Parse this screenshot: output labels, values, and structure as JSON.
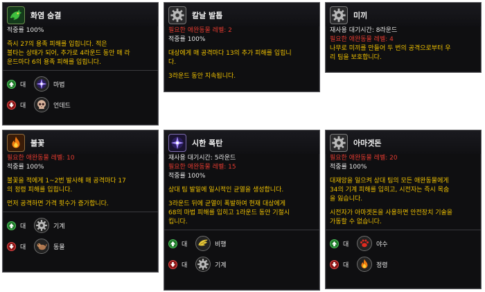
{
  "cards": [
    {
      "title": "화염 숨결",
      "icon": "dragon-head-icon",
      "lines": [
        {
          "text": "적중률 100%",
          "color": "w"
        },
        {
          "text": "",
          "color": "gap"
        },
        {
          "text": "즉시 27의 용족 피해를 입힙니다. 적은",
          "color": "y"
        },
        {
          "text": "불타는 상태가 되어, 추가로 4라운드 동안 매 라",
          "color": "y"
        },
        {
          "text": "운드마다 6의 용족 피해를 입힙니다.",
          "color": "y"
        }
      ],
      "relations": [
        {
          "dir": "up",
          "label": "대",
          "icon": "magic-star-icon",
          "type": "마법"
        },
        {
          "dir": "down",
          "label": "대",
          "icon": "skull-icon",
          "type": "언데드"
        }
      ]
    },
    {
      "title": "칼날 발톱",
      "icon": "gear-icon",
      "lines": [
        {
          "text": "필요한 애완동물 레벨: 2",
          "color": "r"
        },
        {
          "text": "적중률 100%",
          "color": "w"
        },
        {
          "text": "",
          "color": "gap"
        },
        {
          "text": "대상에게 매 공격마다 13의 추가 피해를 입힙니",
          "color": "y"
        },
        {
          "text": "다.",
          "color": "y"
        },
        {
          "text": "",
          "color": "gap"
        },
        {
          "text": "3라운드 동안 지속됩니다.",
          "color": "y"
        }
      ],
      "relations": []
    },
    {
      "title": "미끼",
      "icon": "gear-icon",
      "lines": [
        {
          "text": "재사용 대기시간: 8라운드",
          "color": "w"
        },
        {
          "text": "필요한 애완동물 레벨: 4",
          "color": "r"
        },
        {
          "text": "나무로 미끼를 만들어 두 번의 공격으로부터 우",
          "color": "y"
        },
        {
          "text": "리 팀을 보호합니다.",
          "color": "y"
        }
      ],
      "relations": []
    },
    {
      "title": "불꽃",
      "icon": "flame-icon",
      "lines": [
        {
          "text": "필요한 애완동물 레벨: 10",
          "color": "r"
        },
        {
          "text": "적중률 100%",
          "color": "w"
        },
        {
          "text": "",
          "color": "gap"
        },
        {
          "text": "불꽃을 적에게 1~2번 발사해 매 공격마다 17",
          "color": "y"
        },
        {
          "text": "의 정령 피해를 입힙니다.",
          "color": "y"
        },
        {
          "text": "",
          "color": "gap"
        },
        {
          "text": "먼저 공격하면 가격 횟수가 증가합니다.",
          "color": "y"
        }
      ],
      "relations": [
        {
          "dir": "up",
          "label": "대",
          "icon": "gear-icon",
          "type": "기계"
        },
        {
          "dir": "down",
          "label": "대",
          "icon": "paw-beast-icon",
          "type": "동물"
        }
      ]
    },
    {
      "title": "시한 폭탄",
      "icon": "magic-star-icon",
      "lines": [
        {
          "text": "재사용 대기시간: 5라운드",
          "color": "w"
        },
        {
          "text": "필요한 애완동물 레벨: 15",
          "color": "r"
        },
        {
          "text": "적중률 100%",
          "color": "w"
        },
        {
          "text": "",
          "color": "gap"
        },
        {
          "text": "상대 팀 발밑에 일시적인 균열을 생성합니다.",
          "color": "y"
        },
        {
          "text": "",
          "color": "gap"
        },
        {
          "text": "3라운드 뒤에 균열이 폭발하여 현재 대상에게",
          "color": "y"
        },
        {
          "text": "68의 마법 피해를 입히고 1라운드 동안 기절시",
          "color": "y"
        },
        {
          "text": "킵니다.",
          "color": "y"
        }
      ],
      "relations": [
        {
          "dir": "up",
          "label": "대",
          "icon": "wing-icon",
          "type": "비행"
        },
        {
          "dir": "down",
          "label": "대",
          "icon": "gear-icon",
          "type": "기계"
        }
      ]
    },
    {
      "title": "아마겟돈",
      "icon": "gear-icon",
      "lines": [
        {
          "text": "필요한 애완동물 레벨: 20",
          "color": "r"
        },
        {
          "text": "적중률 100%",
          "color": "w"
        },
        {
          "text": "",
          "color": "gap"
        },
        {
          "text": "대재앙을 일으켜 상대 팀의 모든 애완동물에게",
          "color": "y"
        },
        {
          "text": "34의 기계 피해를 입히고, 시전자는 즉시 목숨",
          "color": "y"
        },
        {
          "text": "을 잃습니다.",
          "color": "y"
        },
        {
          "text": "",
          "color": "gap"
        },
        {
          "text": "시전자가 아마겟돈을 사용하면 안전장치 기술을",
          "color": "y"
        },
        {
          "text": "가동할 수 없습니다.",
          "color": "y"
        }
      ],
      "relations": [
        {
          "dir": "up",
          "label": "대",
          "icon": "paw-icon",
          "type": "야수"
        },
        {
          "dir": "down",
          "label": "대",
          "icon": "flame-icon",
          "type": "정령"
        }
      ]
    }
  ],
  "colors": {
    "bg": "#0f0f11",
    "border": "#5a5a5e",
    "title": "#f2f2f2",
    "requirement": "#e23a30",
    "description": "#f0c200",
    "stat": "#e6e6e6"
  }
}
